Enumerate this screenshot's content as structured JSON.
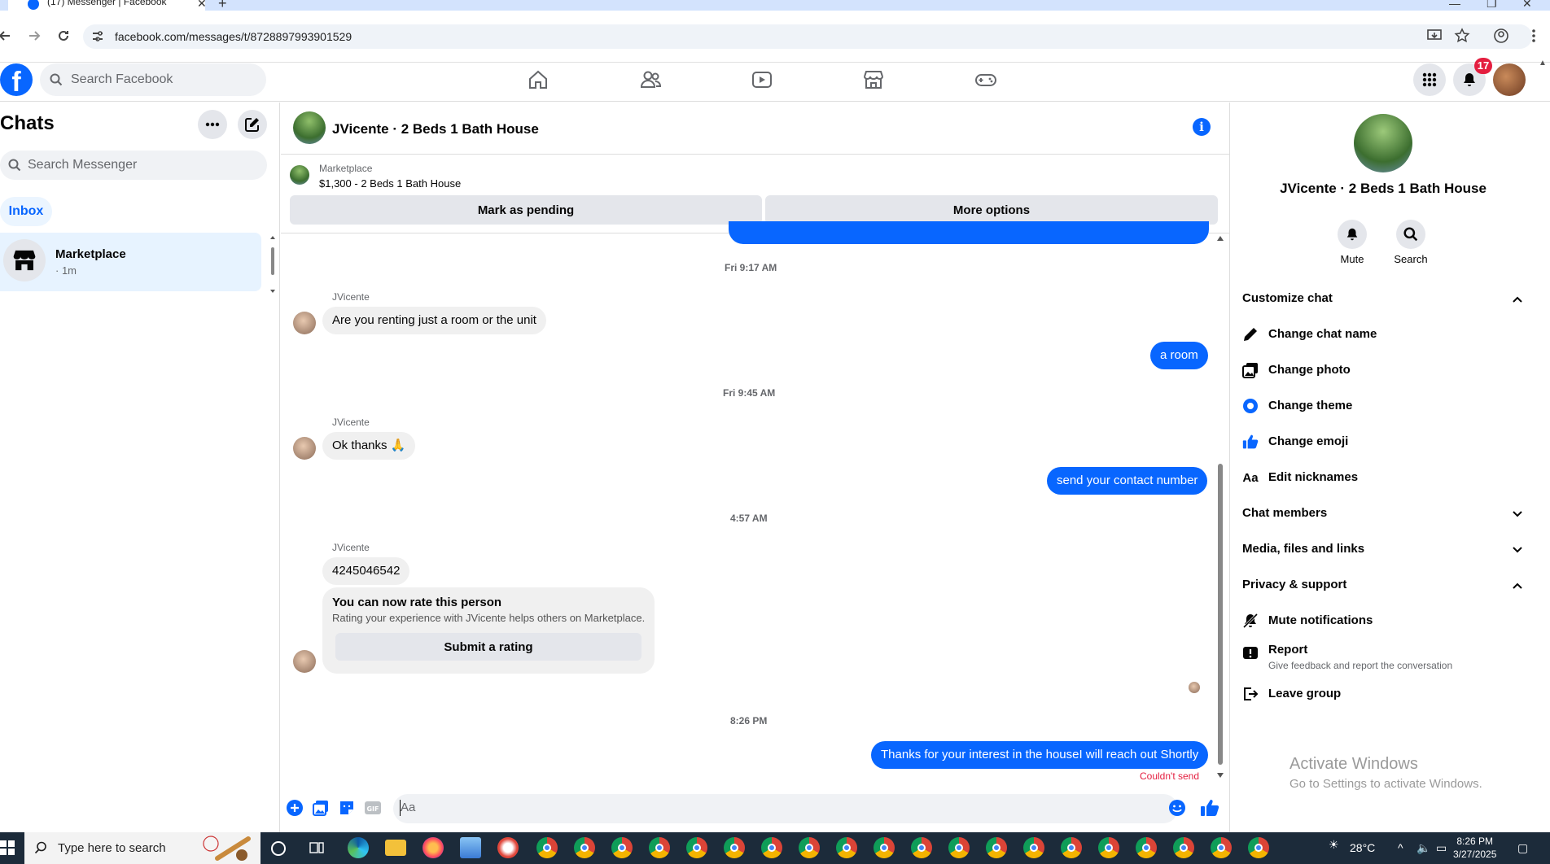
{
  "browser": {
    "tab_title": "(17) Messenger | Facebook",
    "url": "facebook.com/messages/t/8728897993901529"
  },
  "fb_header": {
    "search_placeholder": "Search Facebook",
    "notification_count": "17",
    "nav_icons": [
      "home-icon",
      "friends-icon",
      "video-icon",
      "marketplace-icon",
      "gaming-icon"
    ]
  },
  "sidebar": {
    "title": "Chats",
    "search_placeholder": "Search Messenger",
    "filter_label": "Inbox",
    "chats": [
      {
        "name": "Marketplace",
        "time": "· 1m"
      }
    ]
  },
  "conversation": {
    "title": "JVicente · 2 Beds 1 Bath House",
    "marketplace_label": "Marketplace",
    "listing": "$1,300 - 2 Beds 1 Bath House",
    "mark_pending_label": "Mark as pending",
    "more_options_label": "More options",
    "messages": {
      "ts1": "Fri 9:17 AM",
      "sender1": "JVicente",
      "in1": "Are you renting just a room or the unit",
      "out1": "a room",
      "ts2": "Fri 9:45 AM",
      "sender2": "JVicente",
      "in2": "Ok thanks 🙏",
      "out2": "send your contact number",
      "ts3": "4:57 AM",
      "sender3": "JVicente",
      "in3": "4245046542",
      "rate_title": "You can now rate this person",
      "rate_sub": "Rating your experience with JVicente helps others on Marketplace.",
      "rate_button": "Submit a rating",
      "ts4": "8:26 PM",
      "out3": "Thanks for your interest in the houseI will reach out Shortly",
      "error": "Couldn't send"
    },
    "composer_placeholder": "Aa"
  },
  "right_panel": {
    "title": "JVicente · 2 Beds 1 Bath House",
    "mute_label": "Mute",
    "search_label": "Search",
    "customize_label": "Customize chat",
    "items": {
      "change_name": "Change chat name",
      "change_photo": "Change photo",
      "change_theme": "Change theme",
      "change_emoji": "Change emoji",
      "edit_nicknames": "Edit nicknames"
    },
    "nicknames_icon_text": "Aa",
    "chat_members_label": "Chat members",
    "media_label": "Media, files and links",
    "privacy_label": "Privacy & support",
    "privacy_items": {
      "mute_notifications": "Mute notifications",
      "report": "Report",
      "report_sub": "Give feedback and report the conversation",
      "leave_group": "Leave group"
    },
    "activate_title": "Activate Windows",
    "activate_sub": "Go to Settings to activate Windows."
  },
  "taskbar": {
    "search_placeholder": "Type here to search",
    "weather": "28°C",
    "time": "8:26 PM",
    "date": "3/27/2025"
  },
  "colors": {
    "fb_blue": "#0866ff",
    "bubble_in": "#f0f0f0",
    "error_red": "#e41e3f",
    "taskbar": "#1c2b3a"
  }
}
